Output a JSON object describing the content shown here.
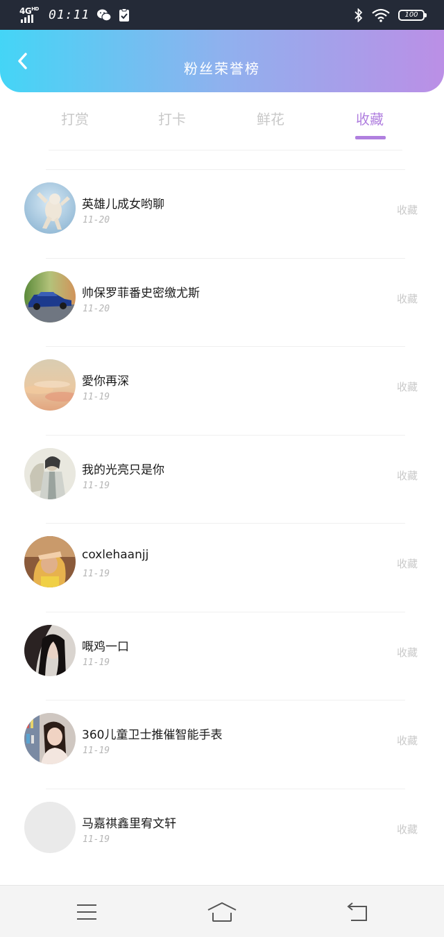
{
  "status_bar": {
    "network": "4G",
    "network_hd": "HD",
    "time": "01:11",
    "battery": "100"
  },
  "header": {
    "title": "粉丝荣誉榜"
  },
  "tabs": [
    {
      "label": "打赏",
      "active": false
    },
    {
      "label": "打卡",
      "active": false
    },
    {
      "label": "鲜花",
      "active": false
    },
    {
      "label": "收藏",
      "active": true
    }
  ],
  "list": [
    {
      "name": "英雄儿成女哟聊",
      "date": "11-20",
      "action": "收藏",
      "avatar": "white dog on blue background"
    },
    {
      "name": "帅保罗菲番史密缴尤斯",
      "date": "11-20",
      "action": "收藏",
      "avatar": "blue car on road"
    },
    {
      "name": "愛你再深",
      "date": "11-19",
      "action": "收藏",
      "avatar": "pastel sunset clouds"
    },
    {
      "name": "我的光亮只是你",
      "date": "11-19",
      "action": "收藏",
      "avatar": "ink painting figure"
    },
    {
      "name": "coxlehaanjj",
      "date": "11-19",
      "action": "收藏",
      "avatar": "woman shielding eyes"
    },
    {
      "name": "嘅鸡一口",
      "date": "11-19",
      "action": "收藏",
      "avatar": "dark haired woman"
    },
    {
      "name": "360儿童卫士推催智能手表",
      "date": "11-19",
      "action": "收藏",
      "avatar": "smiling woman bookshelf"
    },
    {
      "name": "马嘉祺鑫里宥文轩",
      "date": "11-19",
      "action": "收藏",
      "avatar": "empty gray"
    }
  ],
  "colors": {
    "accent": "#b07fdf",
    "status_bar": "#242a37",
    "header_start": "#44d5f6",
    "header_end": "#bb8fe6"
  },
  "nav_icons": [
    "menu-icon",
    "home-icon",
    "back-icon"
  ]
}
